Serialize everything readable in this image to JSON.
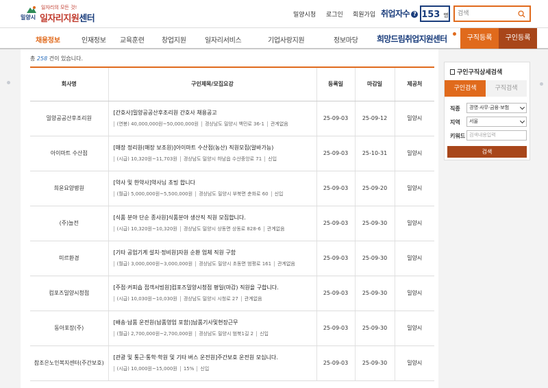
{
  "header": {
    "logo_tagline": "일자리의 모든 것!",
    "logo_city": "밀양시",
    "logo_title_main": "일자리지원",
    "logo_title_suffix": "센터",
    "links": [
      "밀양시청",
      "로그인",
      "회원가입"
    ],
    "job_count_label": "취업자수",
    "job_count_help": "?",
    "job_count_value": "153",
    "job_count_unit": "명",
    "search_placeholder": "검색"
  },
  "nav": {
    "items": [
      "채용정보",
      "인재정보",
      "교육훈련",
      "창업지원",
      "일자리서비스",
      "기업사랑지원",
      "정보마당"
    ],
    "active_index": 0,
    "center_title": "희망드림취업지원센터",
    "buttons": [
      "구직등록",
      "구인등록"
    ],
    "colors": {
      "orange": "#e06a1c",
      "brown": "#a8461a",
      "navy": "#1a3d7c"
    }
  },
  "listing": {
    "total_prefix": "총",
    "total_count": "258",
    "total_suffix": "건이 있습니다.",
    "columns": [
      "회사명",
      "구인제목/모집요강",
      "등록일",
      "마감일",
      "제공처"
    ],
    "rows": [
      {
        "company": "밀양공공산후조리원",
        "title": "[간호사]밀양공공산후조리원 간호사 채용공고",
        "pay": "(연봉) 40,000,000원~50,000,000원",
        "location": "경상남도 밀양시 백민로 36-1",
        "career": "관계없음",
        "registered": "25-09-03",
        "deadline": "25-09-12",
        "provider": "밀양시"
      },
      {
        "company": "아이마트 수산점",
        "title": "[매장 정리원(매장 보조원)]아이마트 수산점(농산) 직원모집(알바가능)",
        "pay": "(시급) 10,320원~11,703원",
        "location": "경상남도 밀양시 하남읍 수산중앙로 71",
        "career": "신입",
        "registered": "25-09-03",
        "deadline": "25-10-31",
        "provider": "밀양시"
      },
      {
        "company": "희윤요양병원",
        "title": "[약사 및 한약사]약사님 초빙 합니다",
        "pay": "(월급) 5,000,000원~5,500,000원",
        "location": "경상남도 밀양시 부북면 춘화로 60",
        "career": "신입",
        "registered": "25-09-03",
        "deadline": "25-09-20",
        "provider": "밀양시"
      },
      {
        "company": "(주)늘전",
        "title": "[식품 분야 단순 종사원]식품분야 생산직 직원 모집합니다.",
        "pay": "(시급) 10,320원~10,320원",
        "location": "경상남도 밀양시 상동면 상동로 828-6",
        "career": "관계없음",
        "registered": "25-09-03",
        "deadline": "25-09-30",
        "provider": "밀양시"
      },
      {
        "company": "미르환경",
        "title": "[기타 공업기계 설치·정비원]자원 순환 업체 직원 구함",
        "pay": "(월급) 3,000,000원~3,000,000원",
        "location": "경상남도 밀양시 초동면 범평로 161",
        "career": "관계없음",
        "registered": "25-09-03",
        "deadline": "25-09-30",
        "provider": "밀양시"
      },
      {
        "company": "컴포즈밀양시청점",
        "title": "[주점·커피숍 접객서빙원]컴포즈밀양시청점 평일(마감) 직원을 구합니다.",
        "pay": "(시급) 10,030원~10,030원",
        "location": "경상남도 밀양시 시청로 27",
        "career": "관계없음",
        "registered": "25-09-03",
        "deadline": "25-09-30",
        "provider": "밀양시"
      },
      {
        "company": "동아포장(주)",
        "title": "[배송·납품 운전원(납품영업 포함)]납품기사및현장근무",
        "pay": "(월급) 2,700,000원~2,700,000원",
        "location": "경상남도 밀양시 범북1길 2",
        "career": "신입",
        "registered": "25-09-03",
        "deadline": "25-09-30",
        "provider": "밀양시"
      },
      {
        "company": "참조은노인복지센터(주간보호)",
        "title": "[관광 및 통근·통학·학원 및 기타 버스 운전원]주간보호 운전원 모십니다.",
        "pay": "(시급) 10,000원~15,000원",
        "location": "15%",
        "career": "신입",
        "registered": "25-09-03",
        "deadline": "25-09-30",
        "provider": "밀양시"
      }
    ]
  },
  "sidebar": {
    "title": "구인구직상세검색",
    "tabs": [
      "구인검색",
      "구직검색"
    ],
    "fields": [
      {
        "label": "직종",
        "value": "경영·사무·금융·보험"
      },
      {
        "label": "지역",
        "value": "서울"
      },
      {
        "label": "키워드",
        "placeholder": "검색내용입력"
      }
    ],
    "button": "검색"
  }
}
